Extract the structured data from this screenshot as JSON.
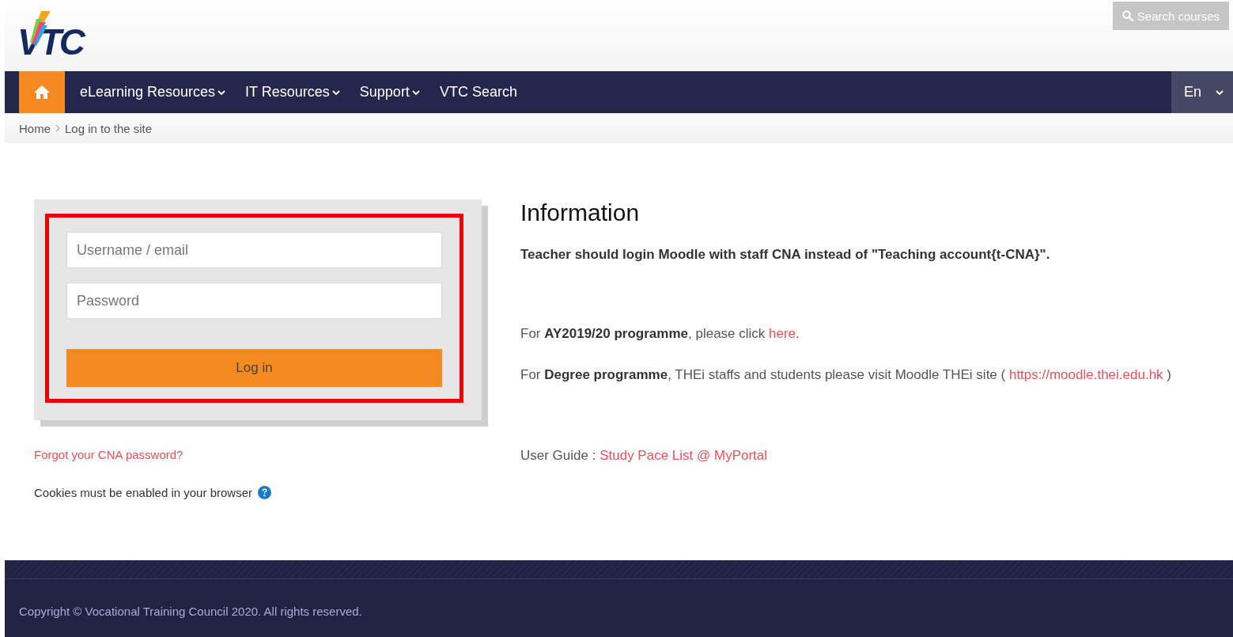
{
  "header": {
    "logo_text": "VTC",
    "search_button": "Search courses"
  },
  "nav": {
    "items": [
      {
        "label": "eLearning Resources",
        "dropdown": true
      },
      {
        "label": "IT Resources",
        "dropdown": true
      },
      {
        "label": "Support",
        "dropdown": true
      },
      {
        "label": "VTC Search",
        "dropdown": false
      }
    ],
    "language": "En"
  },
  "breadcrumb": [
    "Home",
    "Log in to the site"
  ],
  "login": {
    "highlighted": true,
    "username_placeholder": "Username / email",
    "password_placeholder": "Password",
    "button": "Log in",
    "forgot_link": "Forgot your CNA password?",
    "cookies_note": "Cookies must be enabled in your browser"
  },
  "information": {
    "title": "Information",
    "paragraphs": [
      {
        "kind": "bold",
        "before": "Teacher should login Moodle with staff CNA instead of \"Teaching account{t-CNA}\"."
      },
      {
        "kind": "normal",
        "before": "For **AY2019/20 programme**, please click ",
        "link": "here",
        "after": "."
      },
      {
        "kind": "normal",
        "before": "For **Degree programme**, THEi staffs and students please visit Moodle THEi site ( ",
        "link": "https://moodle.thei.edu.hk",
        "after": " )"
      },
      {
        "kind": "spaced",
        "before": "User Guide : ",
        "link": "Study Pace List @ MyPortal"
      }
    ]
  },
  "footer": {
    "copyright": "Copyright © Vocational Training Council 2020. All rights reserved."
  }
}
